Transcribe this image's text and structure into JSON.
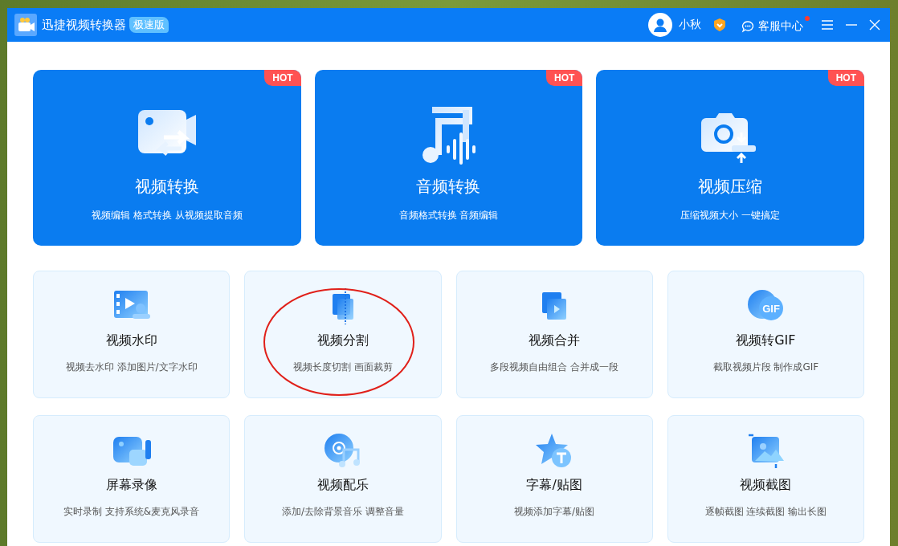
{
  "window": {
    "title": "迅捷视频转换器",
    "edition_badge": "极速版"
  },
  "header": {
    "user_name": "小秋",
    "support_label": "客服中心",
    "support_unread": true
  },
  "featured_tools": [
    {
      "kind": "video-convert",
      "title": "视频转换",
      "subtitle": "视频编辑 格式转换 从视频提取音频",
      "badge": "HOT"
    },
    {
      "kind": "audio-convert",
      "title": "音频转换",
      "subtitle": "音频格式转换 音频编辑",
      "badge": "HOT"
    },
    {
      "kind": "video-compress",
      "title": "视频压缩",
      "subtitle": "压缩视频大小 一键搞定",
      "badge": "HOT"
    }
  ],
  "tools": [
    {
      "kind": "watermark",
      "title": "视频水印",
      "subtitle": "视频去水印 添加图片/文字水印",
      "circled": false
    },
    {
      "kind": "split",
      "title": "视频分割",
      "subtitle": "视频长度切割 画面裁剪",
      "circled": true
    },
    {
      "kind": "merge",
      "title": "视频合并",
      "subtitle": "多段视频自由组合 合并成一段",
      "circled": false
    },
    {
      "kind": "gif",
      "icon_text": "GIF",
      "title": "视频转GIF",
      "subtitle": "截取视频片段 制作成GIF",
      "circled": false
    },
    {
      "kind": "record",
      "title": "屏幕录像",
      "subtitle": "实时录制 支持系统&麦克风录音",
      "circled": false
    },
    {
      "kind": "music",
      "title": "视频配乐",
      "subtitle": "添加/去除背景音乐 调整音量",
      "circled": false
    },
    {
      "kind": "subtitle",
      "title": "字幕/贴图",
      "subtitle": "视频添加字幕/贴图",
      "circled": false
    },
    {
      "kind": "screenshot",
      "title": "视频截图",
      "subtitle": "逐帧截图 连续截图 输出长图",
      "circled": false
    }
  ]
}
